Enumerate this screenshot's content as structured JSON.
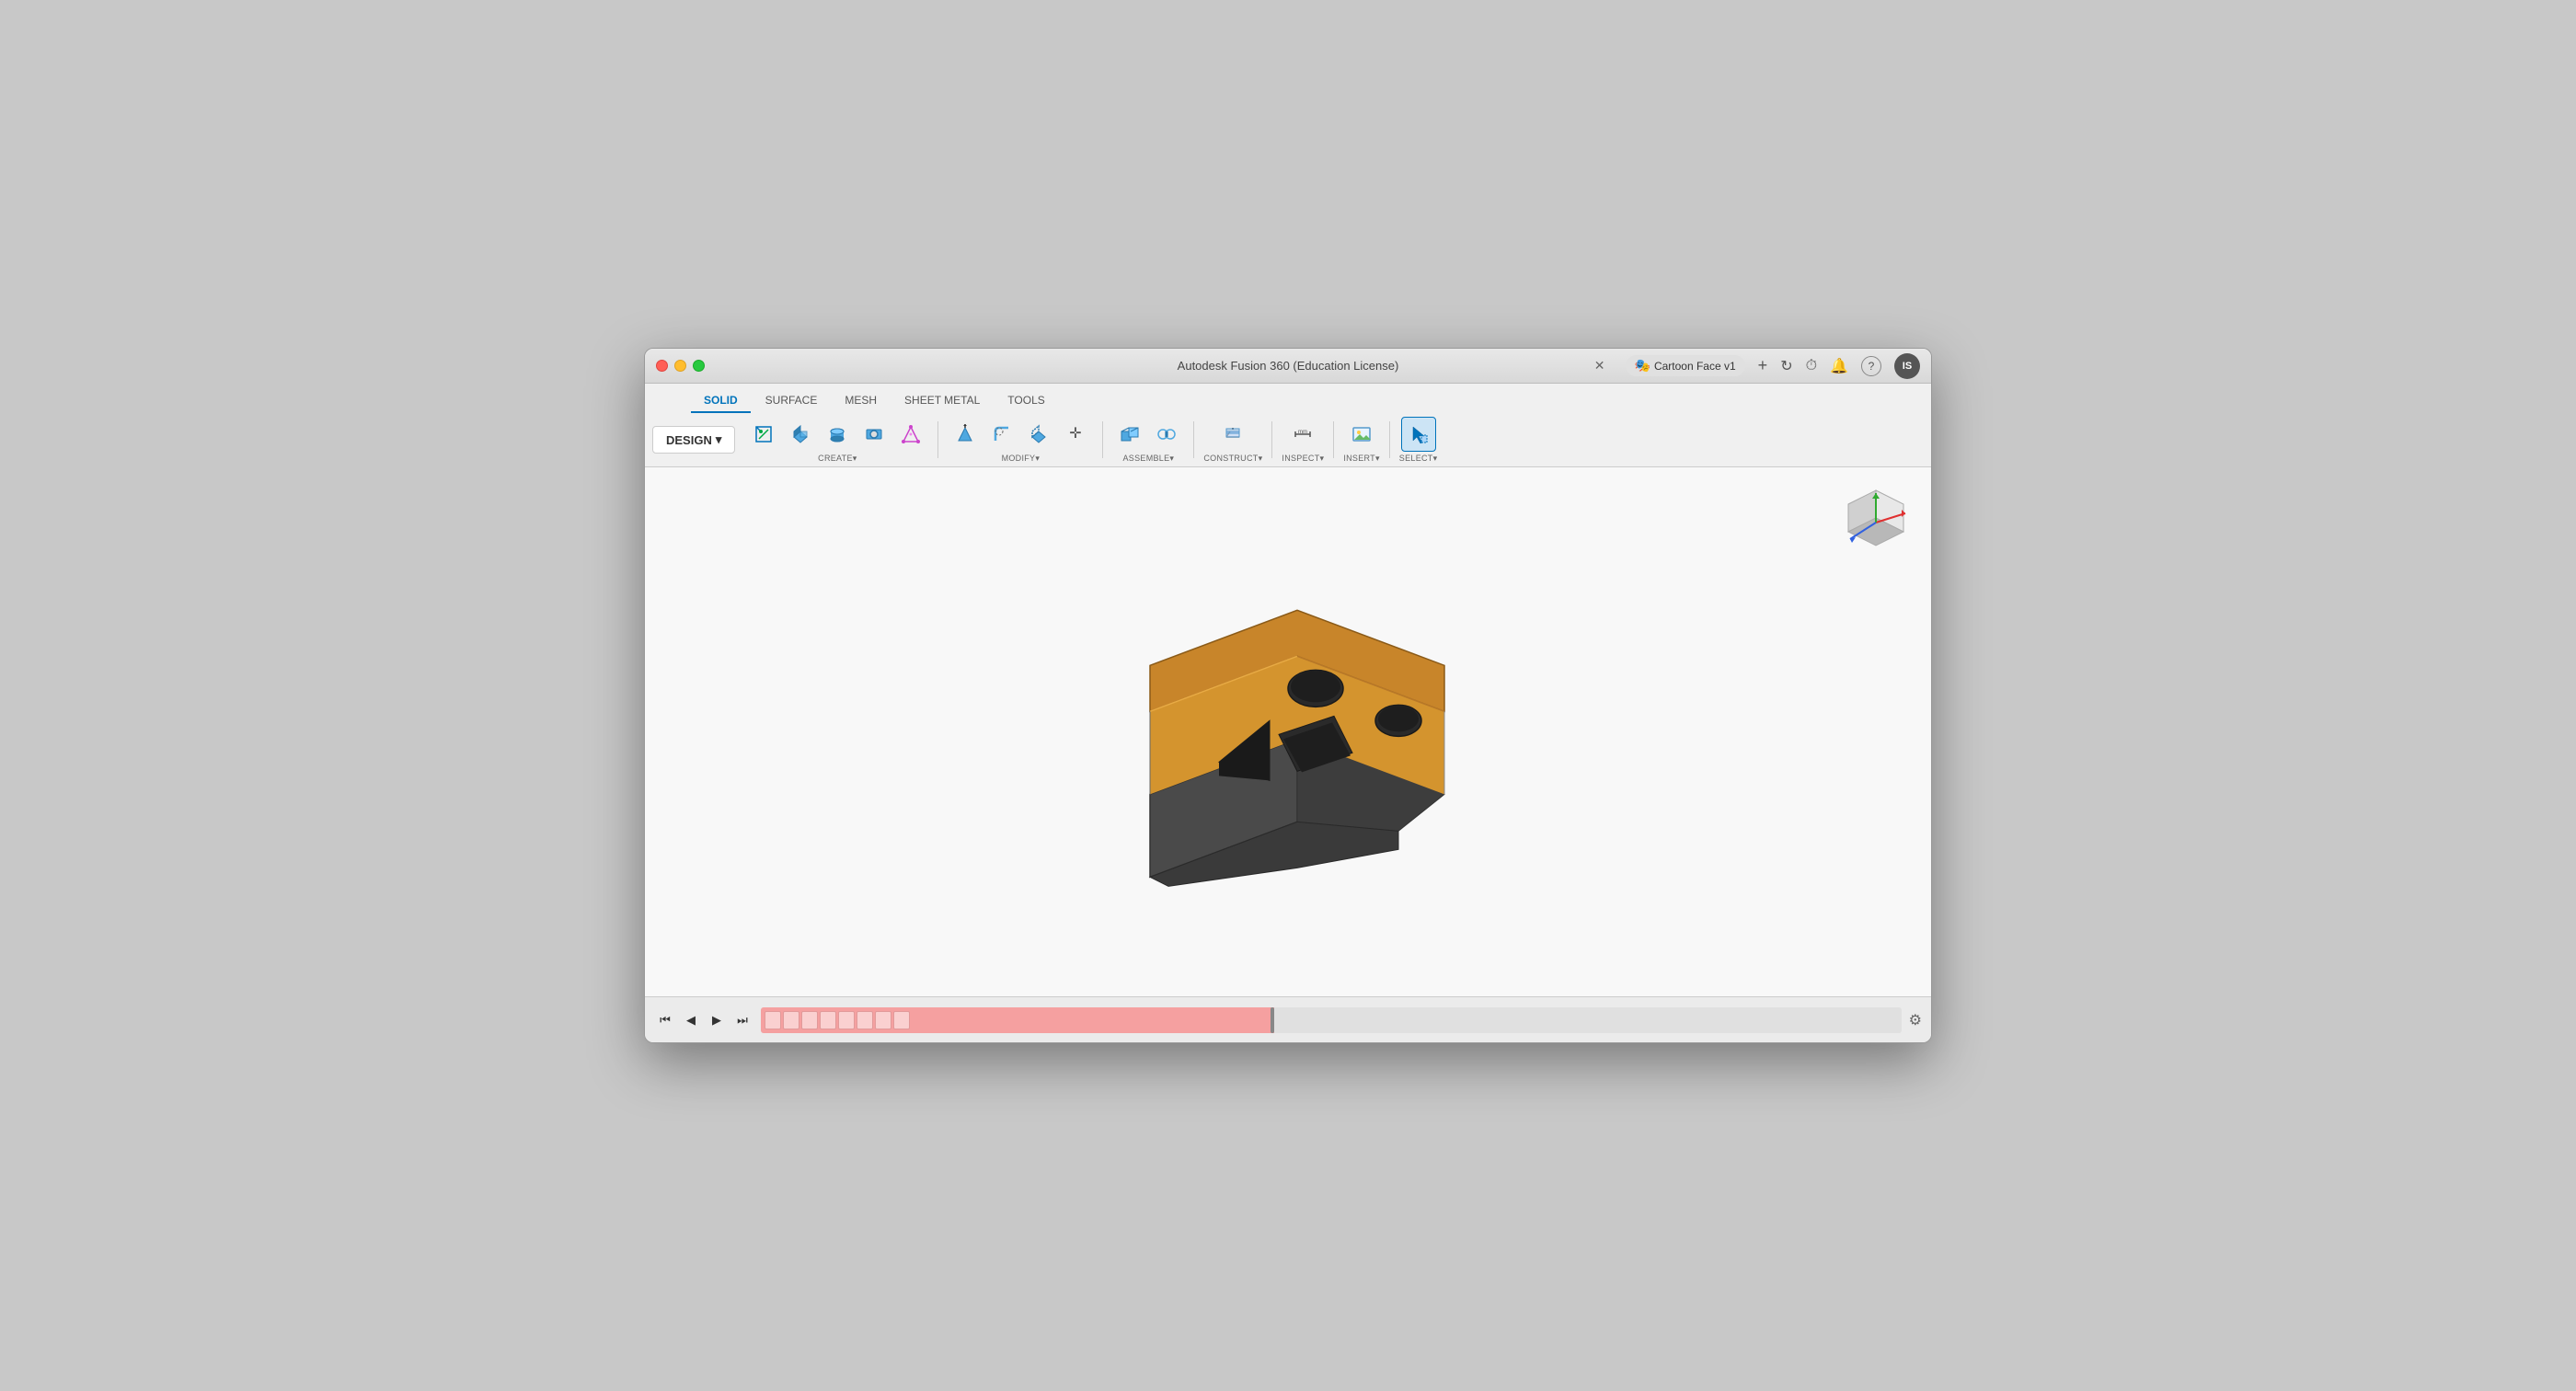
{
  "window": {
    "title": "Autodesk Fusion 360 (Education License)",
    "tab_title": "Cartoon Face v1"
  },
  "traffic_lights": {
    "close": "close",
    "minimize": "minimize",
    "maximize": "maximize"
  },
  "title_bar_right": {
    "add_icon": "+",
    "refresh_icon": "↻",
    "history_icon": "⏱",
    "bell_icon": "🔔",
    "help_icon": "?",
    "user_initials": "IS"
  },
  "toolbar": {
    "design_label": "DESIGN",
    "tabs": [
      {
        "id": "solid",
        "label": "SOLID",
        "active": true
      },
      {
        "id": "surface",
        "label": "SURFACE",
        "active": false
      },
      {
        "id": "mesh",
        "label": "MESH",
        "active": false
      },
      {
        "id": "sheet_metal",
        "label": "SHEET METAL",
        "active": false
      },
      {
        "id": "tools",
        "label": "TOOLS",
        "active": false
      }
    ],
    "groups": [
      {
        "id": "create",
        "label": "CREATE▾"
      },
      {
        "id": "modify",
        "label": "MODIFY▾"
      },
      {
        "id": "assemble",
        "label": "ASSEMBLE▾"
      },
      {
        "id": "construct",
        "label": "CONSTRUCT▾"
      },
      {
        "id": "inspect",
        "label": "INSPECT▾"
      },
      {
        "id": "insert",
        "label": "INSERT▾"
      },
      {
        "id": "select",
        "label": "SELECT▾"
      }
    ]
  },
  "viewport": {
    "background_color": "#f8f8f8"
  },
  "timeline": {
    "controls": [
      "⏮",
      "◀",
      "▶",
      "⏭"
    ],
    "settings_icon": "⚙"
  }
}
